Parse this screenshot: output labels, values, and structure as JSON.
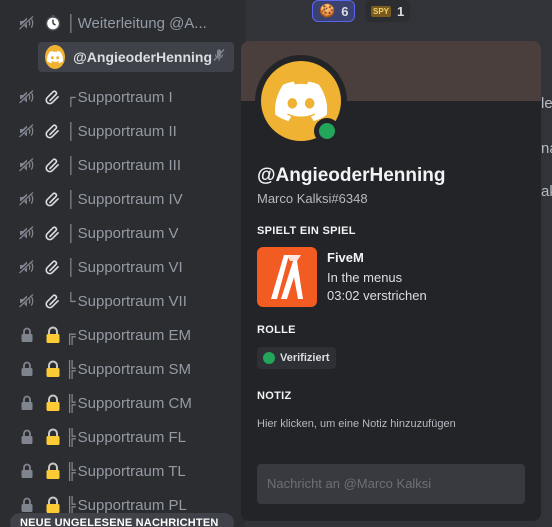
{
  "reactions": [
    {
      "emoji": "🍪",
      "count": "6",
      "active": true
    },
    {
      "emoji": "SPY",
      "count": "1",
      "active": false
    }
  ],
  "channels": [
    {
      "icon": "voice-slash-icon",
      "icon2": "stopwatch-icon",
      "tree": "│",
      "name": "Weiterleitung @A..."
    },
    {
      "icon": "voice-slash-icon",
      "icon2": "paperclip-icon",
      "tree": "┌",
      "name": "Supportraum I"
    },
    {
      "icon": "voice-slash-icon",
      "icon2": "paperclip-icon",
      "tree": "│",
      "name": "Supportraum II"
    },
    {
      "icon": "voice-slash-icon",
      "icon2": "paperclip-icon",
      "tree": "│",
      "name": "Supportraum III"
    },
    {
      "icon": "voice-slash-icon",
      "icon2": "paperclip-icon",
      "tree": "│",
      "name": "Supportraum IV"
    },
    {
      "icon": "voice-slash-icon",
      "icon2": "paperclip-icon",
      "tree": "│",
      "name": "Supportraum V"
    },
    {
      "icon": "voice-slash-icon",
      "icon2": "paperclip-icon",
      "tree": "│",
      "name": "Supportraum VI"
    },
    {
      "icon": "voice-slash-icon",
      "icon2": "paperclip-icon",
      "tree": "└",
      "name": "Supportraum VII"
    },
    {
      "icon": "lock-icon",
      "icon2": "padlock-emoji-icon",
      "tree": "╔",
      "name": "Supportraum EM"
    },
    {
      "icon": "lock-icon",
      "icon2": "padlock-emoji-icon",
      "tree": "╠",
      "name": "Supportraum SM"
    },
    {
      "icon": "lock-icon",
      "icon2": "padlock-emoji-icon",
      "tree": "╠",
      "name": "Supportraum CM"
    },
    {
      "icon": "lock-icon",
      "icon2": "padlock-emoji-icon",
      "tree": "╠",
      "name": "Supportraum FL"
    },
    {
      "icon": "lock-icon",
      "icon2": "padlock-emoji-icon",
      "tree": "╠",
      "name": "Supportraum TL"
    },
    {
      "icon": "lock-icon",
      "icon2": "padlock-emoji-icon",
      "tree": "╠",
      "name": "Supportraum PL"
    }
  ],
  "voice_user": {
    "name": "@AngieoderHenning"
  },
  "new_messages_bar": "NEUE UNGELESENE NACHRICHTEN",
  "chat_fragments": [
    "le",
    "na",
    "ak"
  ],
  "profile": {
    "username": "@AngieoderHenning",
    "tag": "Marco Kalksi#6348",
    "activity_header": "SPIELT EIN SPIEL",
    "game_name": "FiveM",
    "game_state": "In the menus",
    "game_elapsed": "03:02 verstrichen",
    "role_header": "ROLLE",
    "role_name": "Verifiziert",
    "note_header": "NOTIZ",
    "note_placeholder": "Hier klicken, um eine Notiz hinzuzufügen",
    "message_placeholder": "Nachricht an @Marco Kalksi"
  },
  "colors": {
    "avatar": "#f0b232",
    "online": "#23a55a",
    "game_icon": "#f25b22",
    "banner": "#4b3f3d"
  }
}
